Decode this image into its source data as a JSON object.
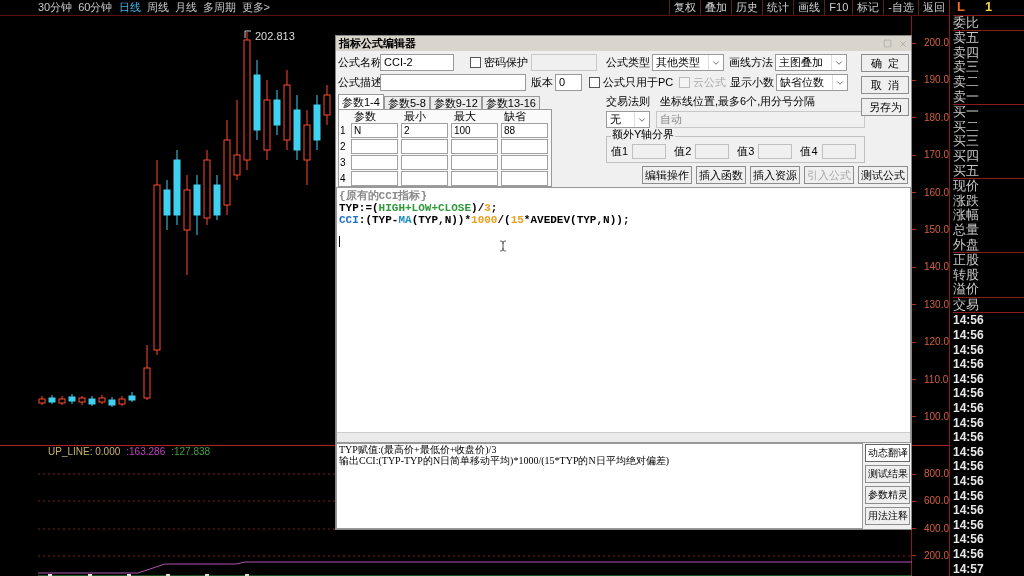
{
  "toolbar": {
    "periods": [
      {
        "label": "30分钟",
        "selected": false
      },
      {
        "label": "60分钟",
        "selected": false
      },
      {
        "label": "日线",
        "selected": true
      },
      {
        "label": "周线",
        "selected": false
      },
      {
        "label": "月线",
        "selected": false
      },
      {
        "label": "多周期",
        "selected": false
      },
      {
        "label": "更多>",
        "selected": false
      }
    ],
    "actions": [
      "复权",
      "叠加",
      "历史",
      "统计",
      "画线",
      "F10",
      "标记",
      "-自选",
      "返回"
    ]
  },
  "chart": {
    "high_label": "202.813",
    "price_axis": [
      "200.0",
      "190.0",
      "180.0",
      "170.0",
      "160.0",
      "150.0",
      "140.0",
      "130.0",
      "120.0",
      "110.0",
      "100.0"
    ],
    "indicator": {
      "labels": [
        {
          "text": "UP_LINE: 0.000",
          "color": "#c8b46e"
        },
        {
          "text": ":163.286",
          "color": "#c040c0"
        },
        {
          "text": ":127.838",
          "color": "#40a040"
        }
      ],
      "axis": [
        "800.0",
        "600.0",
        "400.0",
        "200.0"
      ]
    }
  },
  "dialog": {
    "title": "指标公式编辑器",
    "name_label": "公式名称",
    "name_value": "CCI-2",
    "password": {
      "label": "密码保护",
      "checked": false
    },
    "type_label": "公式类型",
    "type_value": "其他类型",
    "draw_label": "画线方法",
    "draw_value": "主图叠加",
    "desc_label": "公式描述",
    "version_label": "版本",
    "version_value": "0",
    "pc_only": {
      "label": "公式只用于PC",
      "checked": false
    },
    "cloud": {
      "label": "云公式",
      "checked": false,
      "disabled": true
    },
    "decimals_label": "显示小数",
    "decimals_value": "缺省位数",
    "buttons": [
      "确  定",
      "取  消",
      "另存为"
    ],
    "param_tabs": [
      {
        "label": "参数1-4",
        "selected": true
      },
      {
        "label": "参数5-8",
        "selected": false
      },
      {
        "label": "参数9-12",
        "selected": false
      },
      {
        "label": "参数13-16",
        "selected": false
      }
    ],
    "param_headers": [
      "参数",
      "最小",
      "最大",
      "缺省"
    ],
    "params": [
      {
        "index": "1",
        "values": [
          "N",
          "2",
          "100",
          "88"
        ]
      },
      {
        "index": "2"
      },
      {
        "index": "3"
      },
      {
        "index": "4"
      }
    ],
    "trade_rule_label": "交易法则",
    "trade_rule_value": "无",
    "axis_hint": "坐标线位置,最多6个,用分号分隔",
    "axis_value": "自动",
    "extra_y": {
      "title": "额外Y轴分界",
      "labels": [
        "值1",
        "值2",
        "值3",
        "值4"
      ]
    },
    "action_buttons": [
      {
        "label": "编辑操作",
        "disabled": false
      },
      {
        "label": "插入函数",
        "disabled": false
      },
      {
        "label": "插入资源",
        "disabled": false
      },
      {
        "label": "引入公式",
        "disabled": true
      },
      {
        "label": "测试公式",
        "disabled": false
      }
    ],
    "code": [
      [
        {
          "text": "{原有的CCI指标}",
          "kind": "comment"
        }
      ],
      [
        {
          "text": "TYP:=(",
          "kind": "plain"
        },
        {
          "text": "HIGH+LOW+CLOSE",
          "kind": "keyword"
        },
        {
          "text": ")/",
          "kind": "plain"
        },
        {
          "text": "3",
          "kind": "number"
        },
        {
          "text": ";",
          "kind": "plain"
        }
      ],
      [
        {
          "text": "CCI",
          "kind": "output"
        },
        {
          "text": ":(TYP-",
          "kind": "plain"
        },
        {
          "text": "MA",
          "kind": "function"
        },
        {
          "text": "(TYP,N))*",
          "kind": "plain"
        },
        {
          "text": "1000",
          "kind": "number"
        },
        {
          "text": "/(",
          "kind": "plain"
        },
        {
          "text": "15",
          "kind": "number"
        },
        {
          "text": "*AVEDEV(TYP,N));",
          "kind": "plain"
        }
      ]
    ],
    "translation": [
      "TYP赋值:(最高价+最低价+收盘价)/3",
      "输出CCI:(TYP-TYP的N日简单移动平均)*1000/(15*TYP的N日平均绝对偏差)"
    ],
    "side_buttons": [
      {
        "label": "动态翻译",
        "selected": true
      },
      {
        "label": "测试结果",
        "selected": false
      },
      {
        "label": "参数精灵",
        "selected": false
      },
      {
        "label": "用法注释",
        "selected": false
      }
    ]
  },
  "quote_panel": {
    "header": [
      "L",
      "1"
    ],
    "groups": [
      [
        "委比"
      ],
      [
        "卖五",
        "卖四",
        "卖三",
        "卖二",
        "卖一"
      ],
      [
        "买一",
        "买二",
        "买三",
        "买四",
        "买五"
      ],
      [
        "现价",
        "涨跌",
        "涨幅",
        "总量",
        "外盘"
      ],
      [
        "正股",
        "转股",
        "溢价"
      ],
      [
        "交易"
      ]
    ],
    "times": [
      "14:56",
      "14:56",
      "14:56",
      "14:56",
      "14:56",
      "14:56",
      "14:56",
      "14:56",
      "14:56",
      "14:56",
      "14:56",
      "14:56",
      "14:56",
      "14:56",
      "14:56",
      "14:56",
      "14:56",
      "14:57"
    ]
  }
}
